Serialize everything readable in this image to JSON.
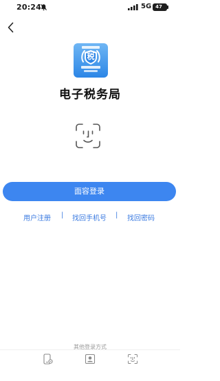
{
  "status_bar": {
    "time": "20:24",
    "network": "5G",
    "battery": "47"
  },
  "header": {
    "back_icon": "chevron-left-icon"
  },
  "app": {
    "logo_icon": "tax-bureau-emblem-icon",
    "logo_char": "税",
    "title": "电子税务局"
  },
  "face": {
    "icon": "face-id-icon"
  },
  "login": {
    "face_login_label": "面容登录"
  },
  "links": {
    "register": "用户注册",
    "separator": "|",
    "retrieve_phone": "找回手机号",
    "retrieve_password": "找回密码"
  },
  "other_login": {
    "label": "其他登录方式",
    "options": [
      {
        "icon": "phone-login-icon"
      },
      {
        "icon": "id-card-login-icon"
      },
      {
        "icon": "face-scan-login-icon"
      }
    ]
  },
  "colors": {
    "accent": "#3d86f0",
    "link": "#3a7ae0",
    "logo_gradient_top": "#6fb6f4",
    "logo_gradient_bottom": "#2c86e6"
  }
}
